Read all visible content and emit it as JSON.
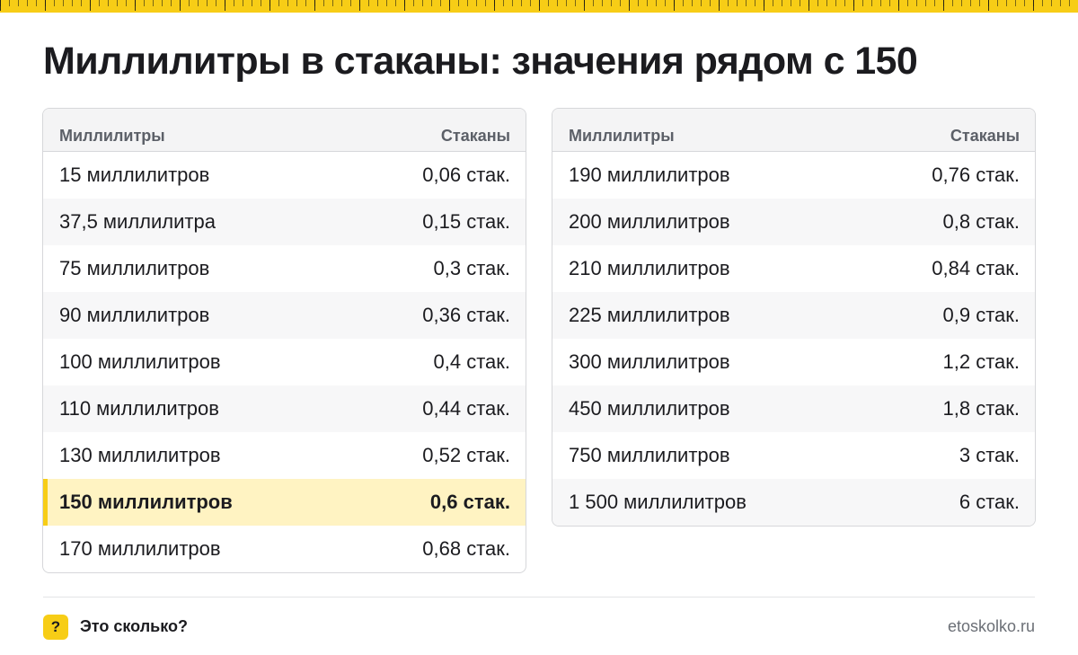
{
  "title": "Миллилитры в стаканы: значения рядом с 150",
  "colors": {
    "accent": "#f7cd16",
    "highlight_bg": "#fff3c2"
  },
  "left_table": {
    "headers": [
      "Миллилитры",
      "Стаканы"
    ],
    "rows": [
      [
        "15 миллилитров",
        "0,06 стак."
      ],
      [
        "37,5 миллилитра",
        "0,15 стак."
      ],
      [
        "75 миллилитров",
        "0,3 стак."
      ],
      [
        "90 миллилитров",
        "0,36 стак."
      ],
      [
        "100 миллилитров",
        "0,4 стак."
      ],
      [
        "110 миллилитров",
        "0,44 стак."
      ],
      [
        "130 миллилитров",
        "0,52 стак."
      ],
      [
        "150 миллилитров",
        "0,6 стак."
      ],
      [
        "170 миллилитров",
        "0,68 стак."
      ]
    ],
    "highlighted_row": 7
  },
  "right_table": {
    "headers": [
      "Миллилитры",
      "Стаканы"
    ],
    "rows": [
      [
        "190 миллилитров",
        "0,76 стак."
      ],
      [
        "200 миллилитров",
        "0,8 стак."
      ],
      [
        "210 миллилитров",
        "0,84 стак."
      ],
      [
        "225 миллилитров",
        "0,9 стак."
      ],
      [
        "300 миллилитров",
        "1,2 стак."
      ],
      [
        "450 миллилитров",
        "1,8 стак."
      ],
      [
        "750 миллилитров",
        "3 стак."
      ],
      [
        "1 500 миллилитров",
        "6 стак."
      ]
    ]
  },
  "footer": {
    "badge_glyph": "?",
    "brand": "Это сколько?",
    "site": "etoskolko.ru"
  }
}
